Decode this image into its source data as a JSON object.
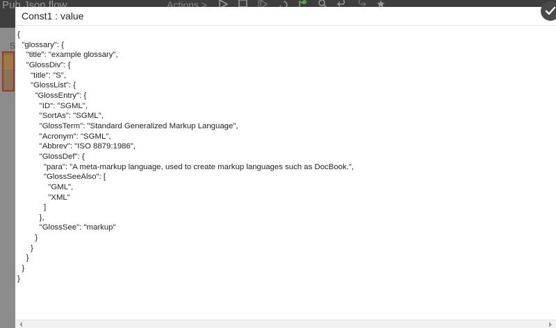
{
  "background": {
    "app_title": "Pub Json flow",
    "actions_label": "Actions >",
    "side_letter": "S",
    "toolbar_icons": [
      "play-icon",
      "stop-icon",
      "step-icon",
      "refresh-icon",
      "flag-icon",
      "search-icon",
      "undo-icon",
      "redo-icon",
      "settings-icon"
    ]
  },
  "dialog": {
    "title": "Const1 : value",
    "content": "{\n  \"glossary\": {\n    \"title\": \"example glossary\",\n    \"GlossDiv\": {\n      \"title\": \"S\",\n      \"GlossList\": {\n        \"GlossEntry\": {\n          \"ID\": \"SGML\",\n          \"SortAs\": \"SGML\",\n          \"GlossTerm\": \"Standard Generalized Markup Language\",\n          \"Acronym\": \"SGML\",\n          \"Abbrev\": \"ISO 8879:1986\",\n          \"GlossDef\": {\n            \"para\": \"A meta-markup language, used to create markup languages such as DocBook.\",\n            \"GlossSeeAlso\": [\n              \"GML\",\n              \"XML\"\n            ]\n          },\n          \"GlossSee\": \"markup\"\n        }\n      }\n    }\n  }\n}"
  },
  "colors": {
    "overlay": "#7a7a7a",
    "dialog_bg": "#ffffff",
    "text": "#222222"
  }
}
